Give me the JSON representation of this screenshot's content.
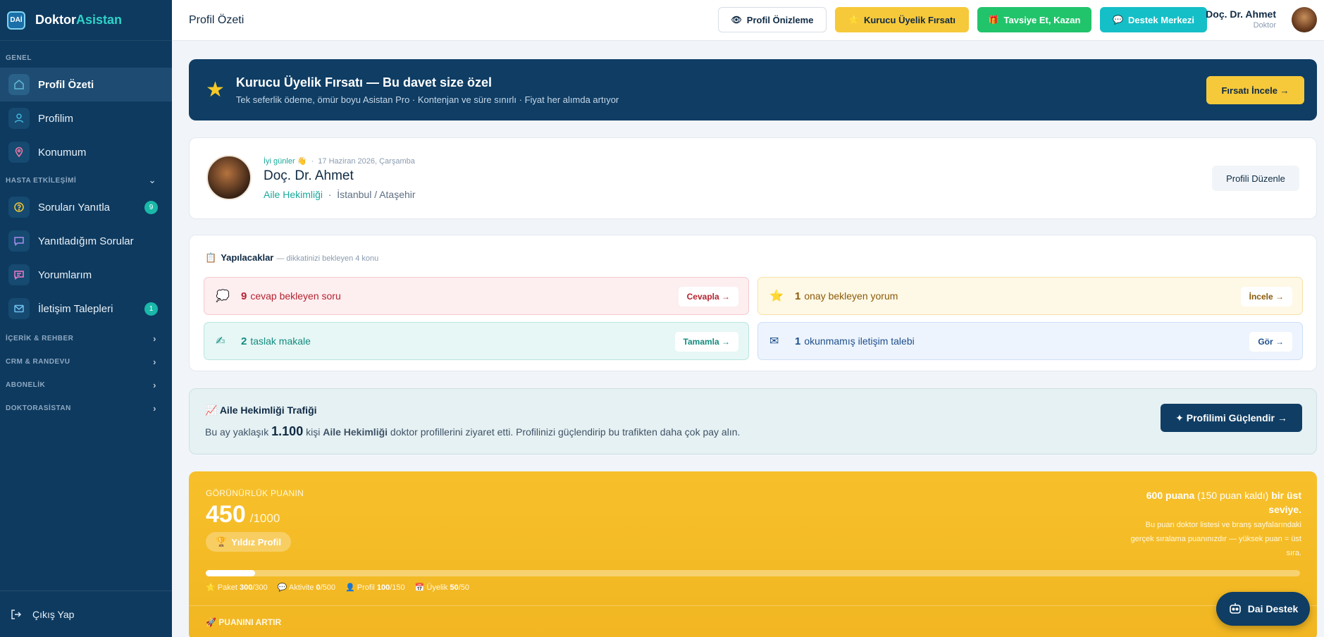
{
  "brand": {
    "logo": "DAİ",
    "name_a": "Doktor",
    "name_b": "Asistan"
  },
  "sidebar": {
    "section_general": "GENEL",
    "section_patient": "HASTA ETKİLEŞİMİ",
    "items": [
      {
        "label": "Profil Özeti",
        "icon": "home-icon"
      },
      {
        "label": "Profilim",
        "icon": "user-icon"
      },
      {
        "label": "Konumum",
        "icon": "location-pin-icon"
      },
      {
        "label": "Soruları Yanıtla",
        "icon": "question-icon",
        "badge": "9"
      },
      {
        "label": "Yanıtladığım Sorular",
        "icon": "chat-icon"
      },
      {
        "label": "Yorumlarım",
        "icon": "comment-icon"
      },
      {
        "label": "İletişim Talepleri",
        "icon": "mail-icon",
        "badge": "1"
      }
    ],
    "groups": [
      "İÇERİK & REHBER",
      "CRM & RANDEVU",
      "ABONELİK",
      "DOKTORASİSTAN"
    ],
    "logout": "Çıkış Yap"
  },
  "header": {
    "title": "Profil Özeti",
    "preview": "Profil Önizleme",
    "founder": "Kurucu Üyelik Fırsatı",
    "refer": "Tavsiye Et, Kazan",
    "support": "Destek Merkezi",
    "user_name": "Doç. Dr. Ahmet",
    "user_role": "Doktor"
  },
  "promo": {
    "title": "Kurucu Üyelik Fırsatı — Bu davet size özel",
    "subtitle": "Tek seferlik ödeme, ömür boyu Asistan Pro · Kontenjan ve süre sınırlı · Fiyat her alımda artıyor",
    "button": "Fırsatı İncele →"
  },
  "profile": {
    "greeting": "İyi günler 👋",
    "date": "17 Haziran 2026, Çarşamba",
    "name": "Doç. Dr. Ahmet",
    "specialty": "Aile Hekimliği",
    "location": "İstanbul / Ataşehir",
    "edit": "Profili Düzenle"
  },
  "todo": {
    "title": "Yapılacaklar",
    "subtitle": "— dikkatinizi bekleyen 4 konu",
    "items": [
      {
        "num": "9",
        "text": "cevap bekleyen soru",
        "btn": "Cevapla →"
      },
      {
        "num": "1",
        "text": "onay bekleyen yorum",
        "btn": "İncele →"
      },
      {
        "num": "2",
        "text": "taslak makale",
        "btn": "Tamamla →"
      },
      {
        "num": "1",
        "text": "okunmamış iletişim talebi",
        "btn": "Gör →"
      }
    ]
  },
  "traffic": {
    "title": "Aile Hekimliği Trafiği",
    "t1": "Bu ay yaklaşık",
    "count": "1.100",
    "t2": "kişi",
    "specialty": "Aile Hekimliği",
    "t3": "doktor profillerini ziyaret etti. Profilinizi güçlendirip bu trafikten daha çok pay alın.",
    "button": "✦ Profilimi Güçlendir →"
  },
  "score": {
    "label": "GÖRÜNÜRLÜK PUANIN",
    "value": "450",
    "max": "/1000",
    "progress": 0.045,
    "badge": "Yıldız Profil",
    "next_a": "600 puana",
    "next_b": "(150 puan kaldı)",
    "next_c": "bir üst seviye.",
    "desc": "Bu puan doktor listesi ve branş sayfalarındaki gerçek sıralama puanınızdır — yüksek puan = üst sıra.",
    "legend": [
      {
        "label": "Paket",
        "val": "300",
        "max": "/300"
      },
      {
        "label": "Aktivite",
        "val": "0",
        "max": "/500"
      },
      {
        "label": "Profil",
        "val": "100",
        "max": "/150"
      },
      {
        "label": "Üyelik",
        "val": "50",
        "max": "/50"
      }
    ],
    "footer": "PUANINI ARTIR"
  },
  "chat": {
    "label": "Dai Destek"
  },
  "colors": {
    "sidebar": "#0e3a5f",
    "accent": "#19b8a8",
    "gold": "#f6c93a"
  }
}
